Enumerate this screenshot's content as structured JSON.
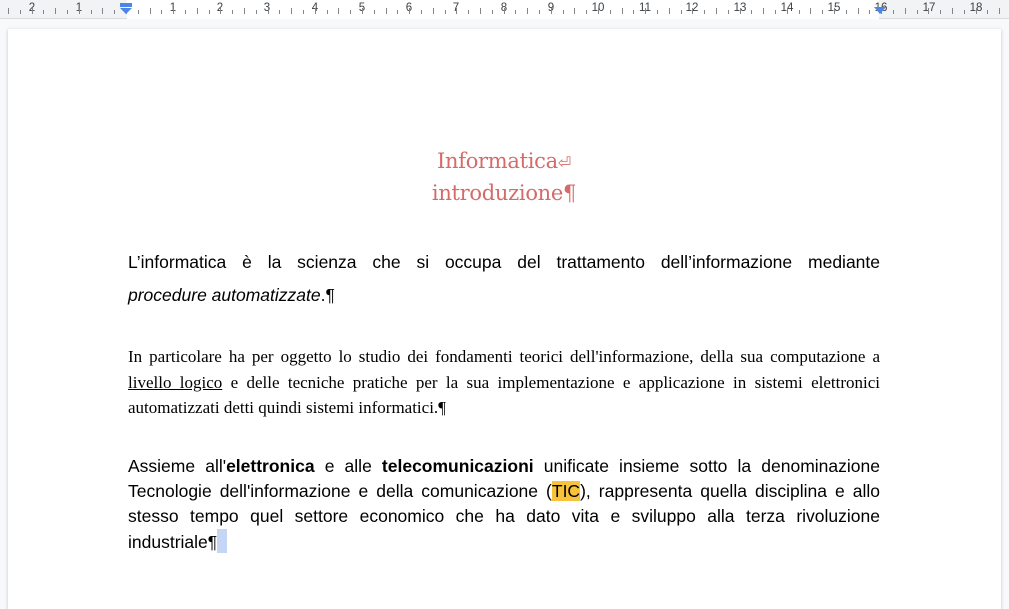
{
  "ruler": {
    "numbers": [
      "2",
      "1",
      "1",
      "2",
      "3",
      "4",
      "5",
      "6",
      "7",
      "8",
      "9",
      "10",
      "11",
      "12",
      "13",
      "14",
      "15",
      "16",
      "17",
      "18"
    ]
  },
  "document": {
    "title_line1": "Informatica",
    "title_line1_mark": "⏎",
    "title_line2": "introduzione",
    "pilcrow": "¶",
    "p1_text_a": "L’informatica è la scienza che si occupa del trattamento dell’informazione mediante",
    "p1_italic": "procedure automatizzate",
    "p1_end": ".",
    "p2_text_a": "In particolare ha per oggetto lo studio dei fondamenti teorici dell'informazione, della sua computazione a ",
    "p2_underlined": "livello logico",
    "p2_text_b": " e delle tecniche pratiche per la sua implementazione e applicazione in sistemi elettronici automatizzati detti quindi sistemi informatici.",
    "p3_text_a": "Assieme all'",
    "p3_bold1": "elettronica",
    "p3_text_b": " e alle ",
    "p3_bold2": "telecomunicazioni",
    "p3_text_c": " unificate insieme sotto la denominazione Tecnologie dell'informazione e della comunicazione (",
    "p3_highlight": "TIC",
    "p3_text_d": "), rappresenta quella disciplina e allo stesso tempo quel settore economico che ha dato vita e sviluppo alla terza rivoluzione industriale"
  },
  "colors": {
    "title": "#d56a6a",
    "highlight": "#f7c33b",
    "selection": "#c5d6f5",
    "indent_marker": "#4a86e8"
  }
}
